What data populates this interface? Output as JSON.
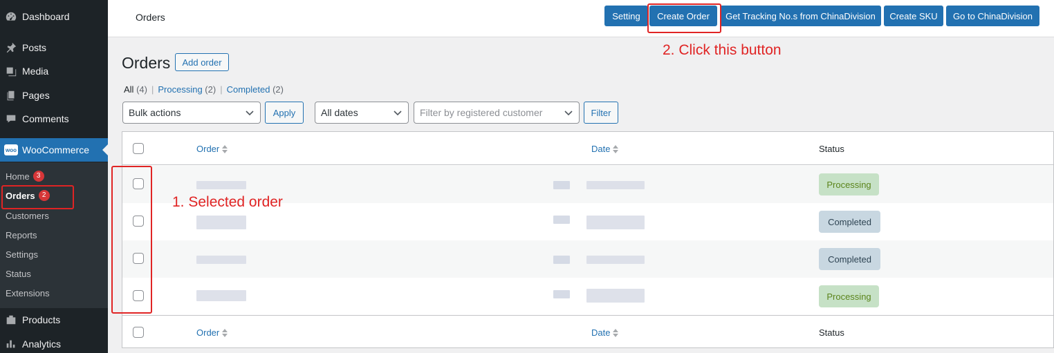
{
  "sidebar": {
    "items": [
      {
        "label": "Dashboard",
        "icon": "dashboard-icon"
      },
      {
        "label": "Posts",
        "icon": "pin-icon"
      },
      {
        "label": "Media",
        "icon": "media-icon"
      },
      {
        "label": "Pages",
        "icon": "pages-icon"
      },
      {
        "label": "Comments",
        "icon": "comment-icon"
      },
      {
        "label": "WooCommerce",
        "icon": "woo-icon",
        "badge_text": "woo"
      },
      {
        "label": "Products",
        "icon": "products-icon"
      },
      {
        "label": "Analytics",
        "icon": "analytics-icon"
      }
    ],
    "submenu": [
      {
        "label": "Home",
        "count": "3"
      },
      {
        "label": "Orders",
        "count": "2"
      },
      {
        "label": "Customers"
      },
      {
        "label": "Reports"
      },
      {
        "label": "Settings"
      },
      {
        "label": "Status"
      },
      {
        "label": "Extensions"
      }
    ]
  },
  "topbar": {
    "title": "Orders",
    "buttons": [
      "Setting",
      "Create Order",
      "Get Tracking No.s from ChinaDivision",
      "Create SKU",
      "Go to ChinaDivision"
    ]
  },
  "page": {
    "heading": "Orders",
    "add_order": "Add order",
    "views": [
      {
        "label": "All",
        "count": "(4)"
      },
      {
        "label": "Processing",
        "count": "(2)"
      },
      {
        "label": "Completed",
        "count": "(2)"
      }
    ],
    "bulk_actions": "Bulk actions",
    "apply": "Apply",
    "all_dates": "All dates",
    "customer_placeholder": "Filter by registered customer",
    "filter": "Filter"
  },
  "table": {
    "columns": {
      "order": "Order",
      "date": "Date",
      "status": "Status"
    },
    "rows": [
      {
        "status": "Processing"
      },
      {
        "status": "Completed"
      },
      {
        "status": "Completed"
      },
      {
        "status": "Processing"
      }
    ]
  },
  "annotations": {
    "selected": "1. Selected order",
    "click": "2. Click this button",
    "color": "#e02424"
  }
}
